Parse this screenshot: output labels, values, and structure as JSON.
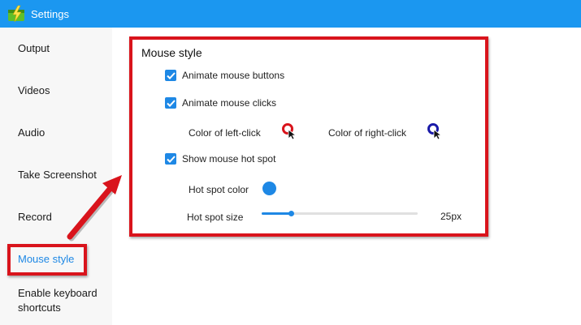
{
  "window": {
    "title": "Settings"
  },
  "sidebar": {
    "items": [
      {
        "label": "Output"
      },
      {
        "label": "Videos"
      },
      {
        "label": "Audio"
      },
      {
        "label": "Take Screenshot"
      },
      {
        "label": "Record"
      },
      {
        "label": "Mouse style",
        "active": true
      },
      {
        "label": "Enable keyboard shortcuts"
      }
    ]
  },
  "panel": {
    "heading": "Mouse style",
    "animate_buttons": {
      "label": "Animate mouse buttons",
      "checked": true
    },
    "animate_clicks": {
      "label": "Animate mouse clicks",
      "checked": true
    },
    "left_click_color": {
      "label": "Color of left-click",
      "color": "#d9141c"
    },
    "right_click_color": {
      "label": "Color of right-click",
      "color": "#1a1aa8"
    },
    "hot_spot": {
      "label": "Show mouse hot spot",
      "checked": true
    },
    "hot_spot_color": {
      "label": "Hot spot color",
      "color": "#1e88e5"
    },
    "hot_spot_size": {
      "label": "Hot spot size",
      "value": 25,
      "value_label": "25px",
      "fraction": 0.19
    }
  },
  "colors": {
    "titlebar": "#1b97f0",
    "accent": "#1e88e5",
    "annotation": "#d9141c"
  },
  "icons": {
    "app": "clapper-lightning-icon",
    "check": "checkmark-icon",
    "cursor": "cursor-ring-icon"
  }
}
